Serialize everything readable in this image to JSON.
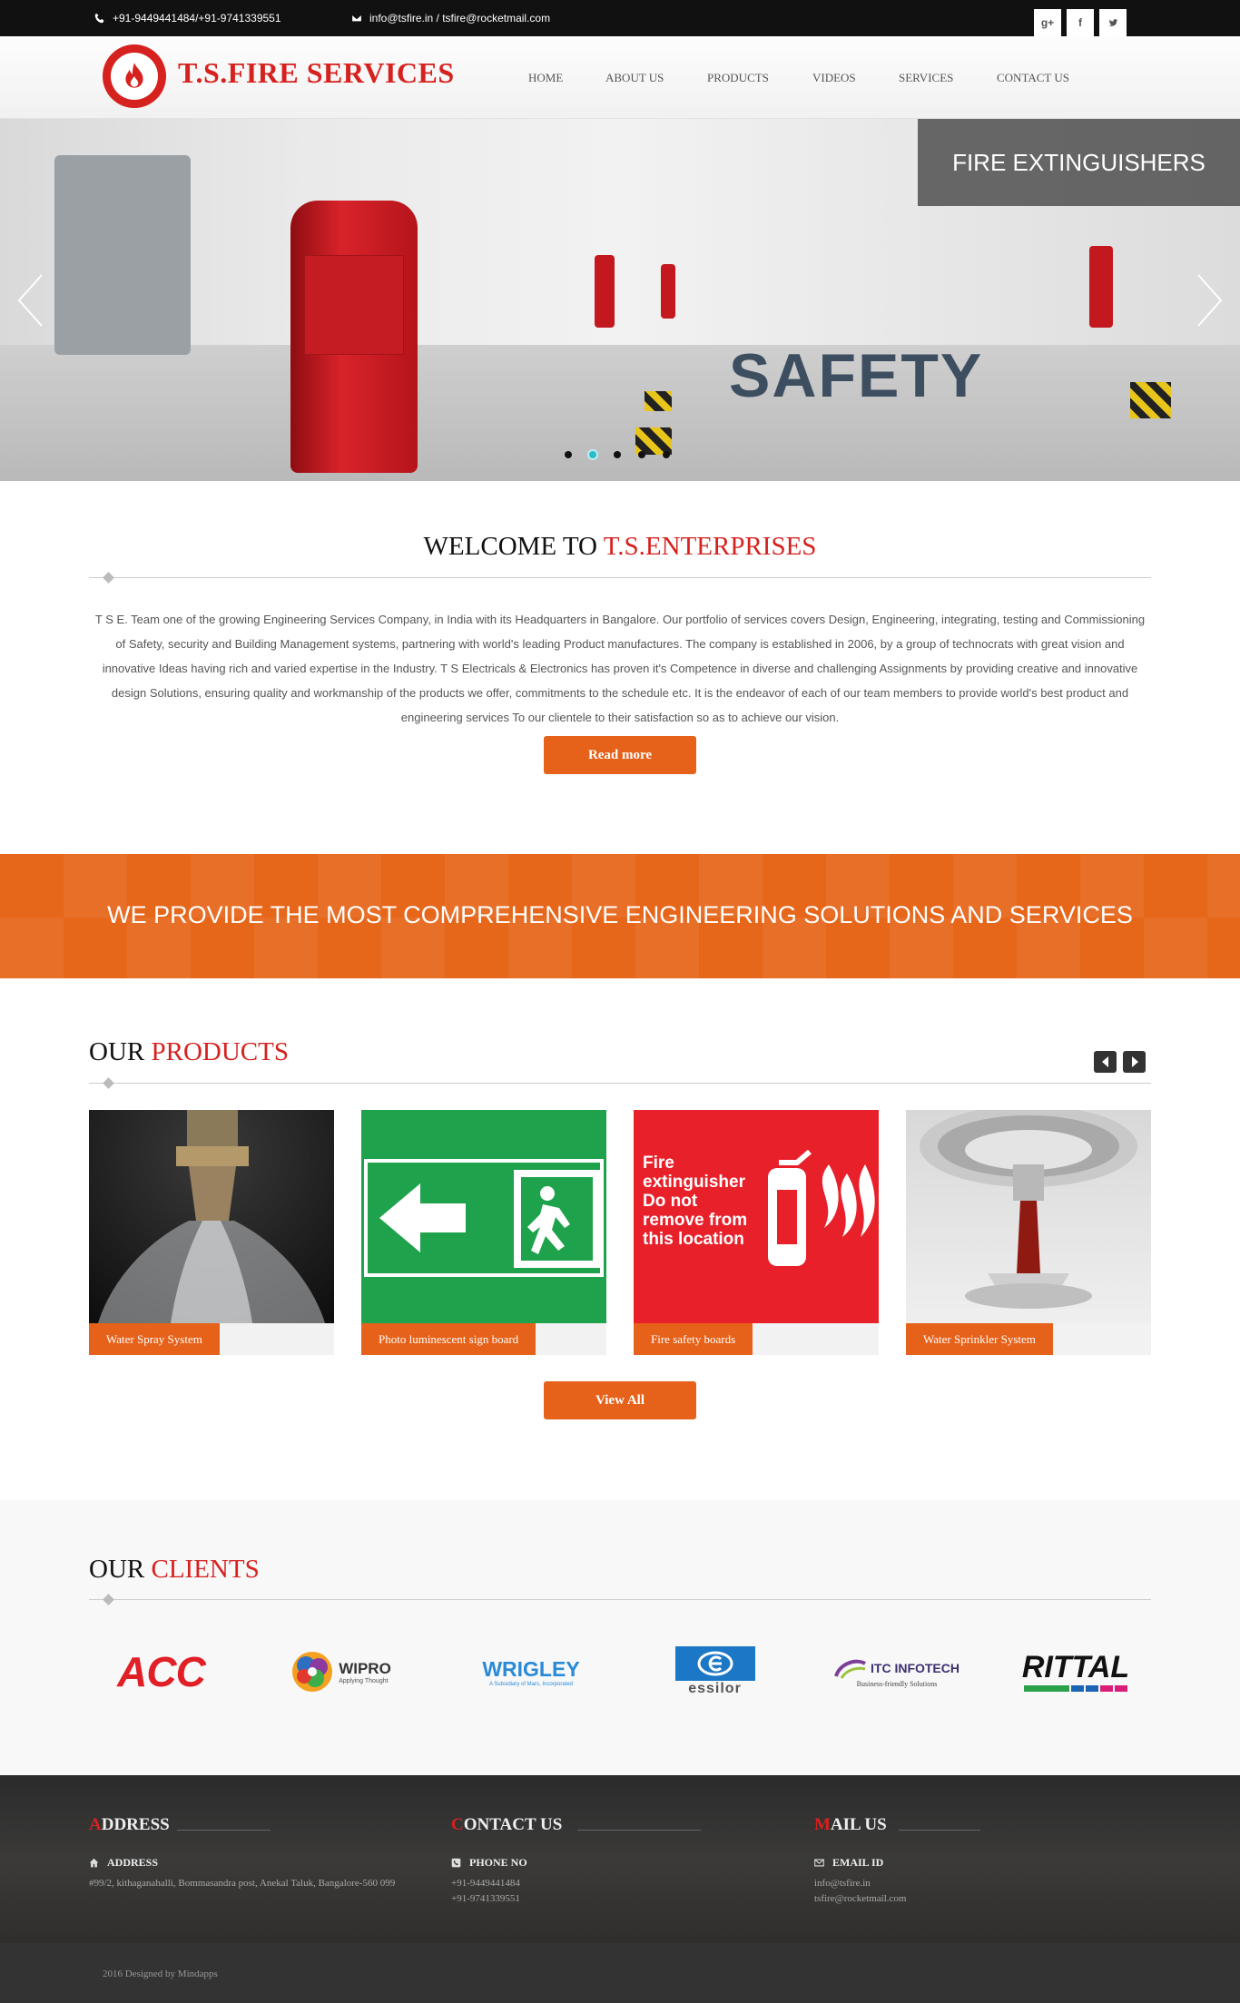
{
  "topbar": {
    "phone": "+91-9449441484/+91-9741339551",
    "email": "info@tsfire.in / tsfire@rocketmail.com",
    "social": [
      "g+",
      "f",
      "t"
    ]
  },
  "header": {
    "brand": "T.S.FIRE SERVICES",
    "nav": [
      "HOME",
      "ABOUT US",
      "PRODUCTS",
      "VIDEOS",
      "SERVICES",
      "CONTACT US"
    ]
  },
  "hero": {
    "caption": "FIRE EXTINGUISHERS",
    "image_text": "SAFETY",
    "slide_count": 5,
    "active_slide": 2
  },
  "welcome": {
    "title_prefix": "WELCOME TO ",
    "title_highlight": "T.S.ENTERPRISES",
    "body": "T S E. Team one of the growing Engineering Services Company, in India with its Headquarters in Bangalore. Our portfolio of services covers Design, Engineering, integrating, testing and Commissioning of Safety, security and Building Management systems, partnering with world's leading Product manufactures. The company is established in 2006, by a group of technocrats with great vision and innovative Ideas having rich and varied expertise in the Industry. T S Electricals & Electronics has proven it's Competence in diverse and challenging Assignments by providing creative and innovative design Solutions, ensuring quality and workmanship of the products we offer, commitments to the schedule etc. It is the endeavor of each of our team members to provide world's best product and engineering services To our clientele to their satisfaction so as to achieve our vision.",
    "read_more": "Read more"
  },
  "banner": {
    "text": "WE PROVIDE THE MOST COMPREHENSIVE ENGINEERING SOLUTIONS AND SERVICES"
  },
  "products": {
    "title_prefix": "OUR ",
    "title_highlight": "PRODUCTS",
    "items": [
      {
        "label": "Water Spray System"
      },
      {
        "label": "Photo luminescent sign board"
      },
      {
        "label": "Fire safety boards",
        "sign_text": "Fire extinguisher Do not remove from this location"
      },
      {
        "label": "Water Sprinkler System"
      }
    ],
    "view_all": "View All"
  },
  "clients": {
    "title_prefix": "OUR ",
    "title_highlight": "CLIENTS",
    "logos": [
      "ACC",
      "WIPRO",
      "Applying Thought",
      "WRIGLEY",
      "A Subsidiary of Mars, Incorporated",
      "essilor",
      "ITC INFOTECH",
      "Business-friendly Solutions",
      "RITTAL"
    ]
  },
  "footer": {
    "address": {
      "heading_first": "A",
      "heading_rest": "DDRESS",
      "sub": "ADDRESS",
      "text": "#99/2, kithaganahalli, Bommasandra post, Anekal Taluk, Bangalore-560 099"
    },
    "contact": {
      "heading_first": "C",
      "heading_rest": "ONTACT US",
      "sub": "PHONE NO",
      "lines": [
        "+91-9449441484",
        "+91-9741339551"
      ]
    },
    "mail": {
      "heading_first": "M",
      "heading_rest": "AIL US",
      "sub": "EMAIL ID",
      "lines": [
        "info@tsfire.in",
        "tsfire@rocketmail.com"
      ]
    },
    "copyright": "2016 Designed by Mindapps"
  },
  "colors": {
    "brand_red": "#d6221f",
    "accent_orange": "#e6621a",
    "topbar_bg": "#111111",
    "slider_dot_active": "#2bbdc8"
  }
}
